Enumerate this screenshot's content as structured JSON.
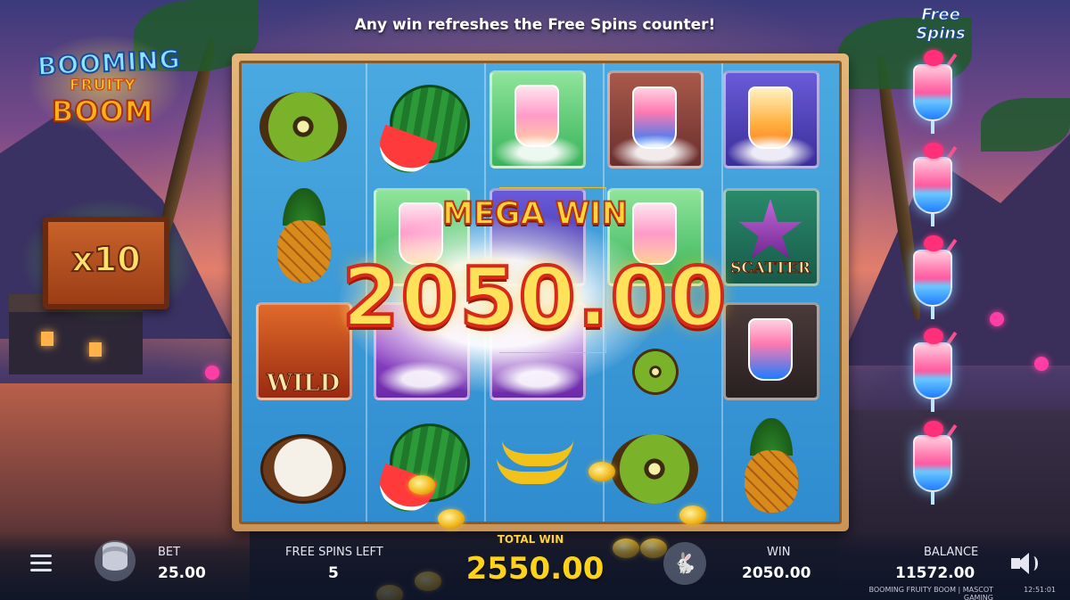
{
  "banner": "Any win refreshes the Free Spins counter!",
  "logo": {
    "line1": "BOOMING",
    "line2": "FRUITY",
    "line3": "BOOM"
  },
  "multiplier": {
    "label": "x10"
  },
  "free_spins_panel": {
    "title_line1": "Free",
    "title_line2": "Spins",
    "icon": "cocktail-icon",
    "count": 5
  },
  "reels": {
    "rows": 4,
    "columns": 5,
    "symbol_labels": {
      "wild": "WILD",
      "scatter": "SCATTER"
    }
  },
  "mega_win": {
    "title": "MEGA WIN",
    "amount": "2050.00"
  },
  "hud": {
    "bet_label": "BET",
    "bet_value": "25.00",
    "free_spins_left_label": "FREE SPINS LEFT",
    "free_spins_left_value": "5",
    "total_win_label": "TOTAL WIN",
    "total_win_value": "2550.00",
    "win_label": "WIN",
    "win_value": "2050.00",
    "balance_label": "BALANCE",
    "balance_value": "11572.00",
    "footer_text": "BOOMING FRUITY BOOM | MASCOT GAMING",
    "clock": "12:51:01",
    "icons": {
      "menu": "menu-icon",
      "bet": "chips-icon",
      "turbo": "rabbit-icon",
      "sound": "speaker-icon"
    }
  },
  "colors": {
    "gold_text": "#ffd21a",
    "win_red_stroke": "#d8281a",
    "frame_wood": "#c99455",
    "reel_blue": "#2f8ccf"
  }
}
